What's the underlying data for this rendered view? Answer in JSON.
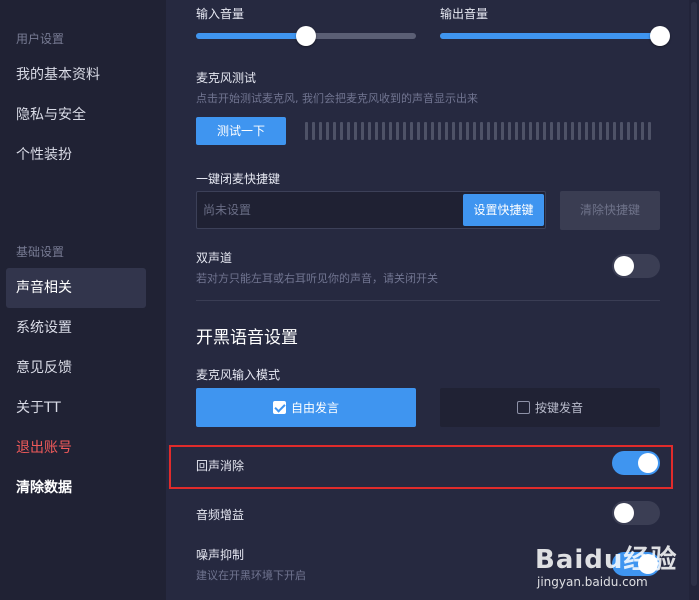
{
  "sidebar": {
    "groups": [
      {
        "title": "用户设置"
      },
      {
        "title": "基础设置"
      }
    ],
    "items": [
      {
        "label": "我的基本资料"
      },
      {
        "label": "隐私与安全"
      },
      {
        "label": "个性装扮"
      },
      {
        "label": "声音相关"
      },
      {
        "label": "系统设置"
      },
      {
        "label": "意见反馈"
      },
      {
        "label": "关于TT"
      },
      {
        "label": "退出账号"
      },
      {
        "label": "清除数据"
      }
    ]
  },
  "audio": {
    "input_volume_label": "输入音量",
    "input_volume_level": 0.5,
    "output_volume_label": "输出音量",
    "output_volume_level": 1.0
  },
  "mic_test": {
    "title": "麦克风测试",
    "hint": "点击开始测试麦克风, 我们会把麦克风收到的声音显示出来",
    "button": "测试一下"
  },
  "hotkey": {
    "title": "一键闭麦快捷键",
    "placeholder": "尚未设置",
    "value": "",
    "set_button": "设置快捷键",
    "clear_button": "清除快捷键"
  },
  "stereo": {
    "title": "双声道",
    "hint": "若对方只能左耳或右耳听见你的声音，请关闭开关",
    "enabled": false
  },
  "voice_section": {
    "heading": "开黑语音设置",
    "mic_mode_label": "麦克风输入模式",
    "mode_free": "自由发言",
    "mode_ptt": "按键发音",
    "selected_mode": "自由发言"
  },
  "echo_cancel": {
    "title": "回声消除",
    "enabled": true
  },
  "audio_gain": {
    "title": "音频增益",
    "enabled": false
  },
  "noise_suppress": {
    "title": "噪声抑制",
    "hint": "建议在开黑环境下开启",
    "enabled": true
  },
  "watermark": {
    "logo": "Baidu经验",
    "sub": "jingyan.baidu.com"
  },
  "colors": {
    "accent": "#3f95f0",
    "highlight": "#e02b2b",
    "danger": "#f05a5a"
  }
}
